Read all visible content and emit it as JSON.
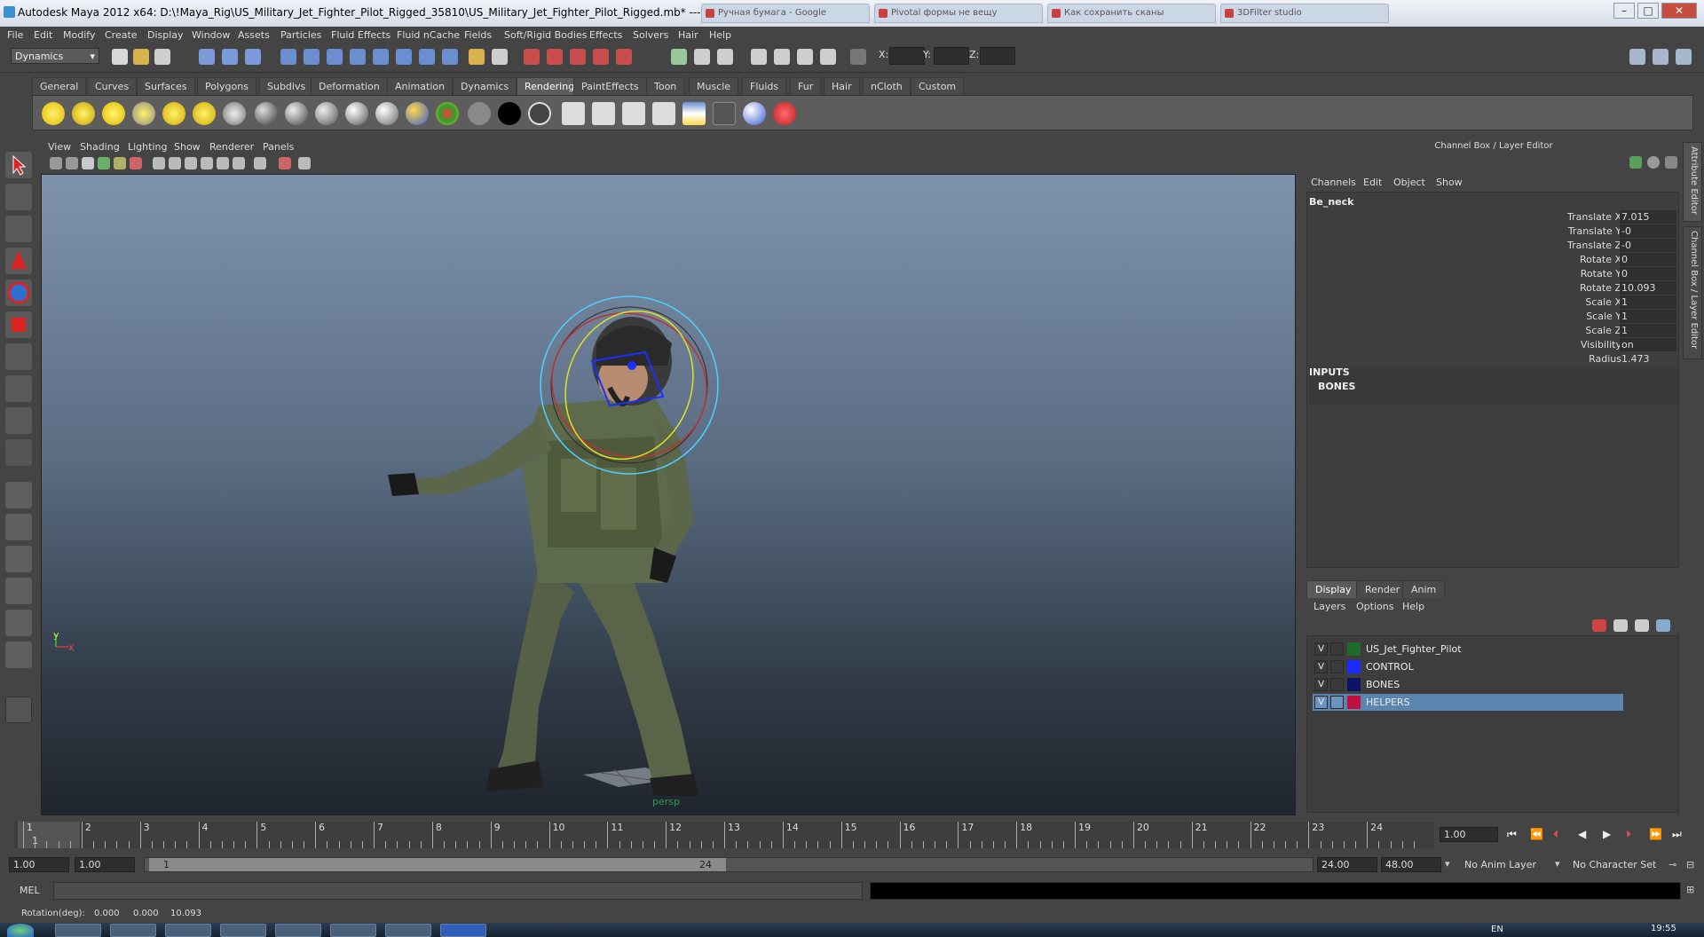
{
  "window": {
    "title": "Autodesk Maya 2012 x64: D:\\!Maya_Rig\\US_Military_Jet_Fighter_Pilot_Rigged_35810\\US_Military_Jet_Fighter_Pilot_Rigged.mb*   ---   Be_neck",
    "browser_tabs": [
      "Ручная бумага - Google",
      "Pivotal формы не вещу",
      "Как сохранить сканы",
      "3DFilter studio"
    ],
    "controls": [
      "–",
      "□",
      "✕"
    ]
  },
  "menubar": [
    "File",
    "Edit",
    "Modify",
    "Create",
    "Display",
    "Window",
    "Assets",
    "Particles",
    "Fluid Effects",
    "Fluid nCache",
    "Fields",
    "Soft/Rigid Bodies",
    "Effects",
    "Solvers",
    "Hair",
    "Help"
  ],
  "statusline": {
    "mode": "Dynamics",
    "x_label": "X:",
    "y_label": "Y:",
    "z_label": "Z:"
  },
  "shelf": {
    "tabs": [
      "General",
      "Curves",
      "Surfaces",
      "Polygons",
      "Subdivs",
      "Deformation",
      "Animation",
      "Dynamics",
      "Rendering",
      "PaintEffects",
      "Toon",
      "Muscle",
      "Fluids",
      "Fur",
      "Hair",
      "nCloth",
      "Custom"
    ],
    "active": "Rendering"
  },
  "viewport": {
    "menu": [
      "View",
      "Shading",
      "Lighting",
      "Show",
      "Renderer",
      "Panels"
    ],
    "camera_label": "persp",
    "axis_y": "y",
    "axis_x": "x"
  },
  "channel_box": {
    "title": "Channel Box / Layer Editor",
    "menu": [
      "Channels",
      "Edit",
      "Object",
      "Show"
    ],
    "object": "Be_neck",
    "channels": [
      {
        "label": "Translate X",
        "value": "7.015"
      },
      {
        "label": "Translate Y",
        "value": "-0"
      },
      {
        "label": "Translate Z",
        "value": "-0"
      },
      {
        "label": "Rotate X",
        "value": "0"
      },
      {
        "label": "Rotate Y",
        "value": "0"
      },
      {
        "label": "Rotate Z",
        "value": "10.093"
      },
      {
        "label": "Scale X",
        "value": "1"
      },
      {
        "label": "Scale Y",
        "value": "1"
      },
      {
        "label": "Scale Z",
        "value": "1"
      },
      {
        "label": "Visibility",
        "value": "on"
      },
      {
        "label": "Radius",
        "value": "1.473"
      }
    ],
    "inputs_label": "INPUTS",
    "inputs_item": "BONES",
    "side_tabs": [
      "Attribute Editor",
      "Channel Box / Layer Editor"
    ]
  },
  "layer_editor": {
    "tabs": [
      "Display",
      "Render",
      "Anim"
    ],
    "active_tab": "Display",
    "menu": [
      "Layers",
      "Options",
      "Help"
    ],
    "layers": [
      {
        "vis": "V",
        "name": "US_Jet_Fighter_Pilot",
        "color": "#1f6b2a"
      },
      {
        "vis": "V",
        "name": "CONTROL",
        "color": "#1a2bff"
      },
      {
        "vis": "V",
        "name": "BONES",
        "color": "#0c1466"
      },
      {
        "vis": "V",
        "name": "HELPERS",
        "color": "#c01040"
      }
    ],
    "selected": "HELPERS"
  },
  "timeline": {
    "ticks": [
      "1",
      "2",
      "3",
      "4",
      "5",
      "6",
      "7",
      "8",
      "9",
      "10",
      "11",
      "12",
      "13",
      "14",
      "15",
      "16",
      "17",
      "18",
      "19",
      "20",
      "21",
      "22",
      "23",
      "24"
    ],
    "current_frame": "1",
    "current_field": "1.00"
  },
  "range": {
    "start": "1.00",
    "anim_start": "1.00",
    "range_start_label": "1",
    "range_end_label": "24",
    "range_end": "24.00",
    "anim_end": "48.00",
    "anim_layer": "No Anim Layer",
    "character_set": "No Character Set"
  },
  "command_line": {
    "label": "MEL"
  },
  "help_line": {
    "label": "Rotation(deg):",
    "v1": "0.000",
    "v2": "0.000",
    "v3": "10.093"
  },
  "taskbar": {
    "lang": "EN",
    "clock": "19:55"
  }
}
